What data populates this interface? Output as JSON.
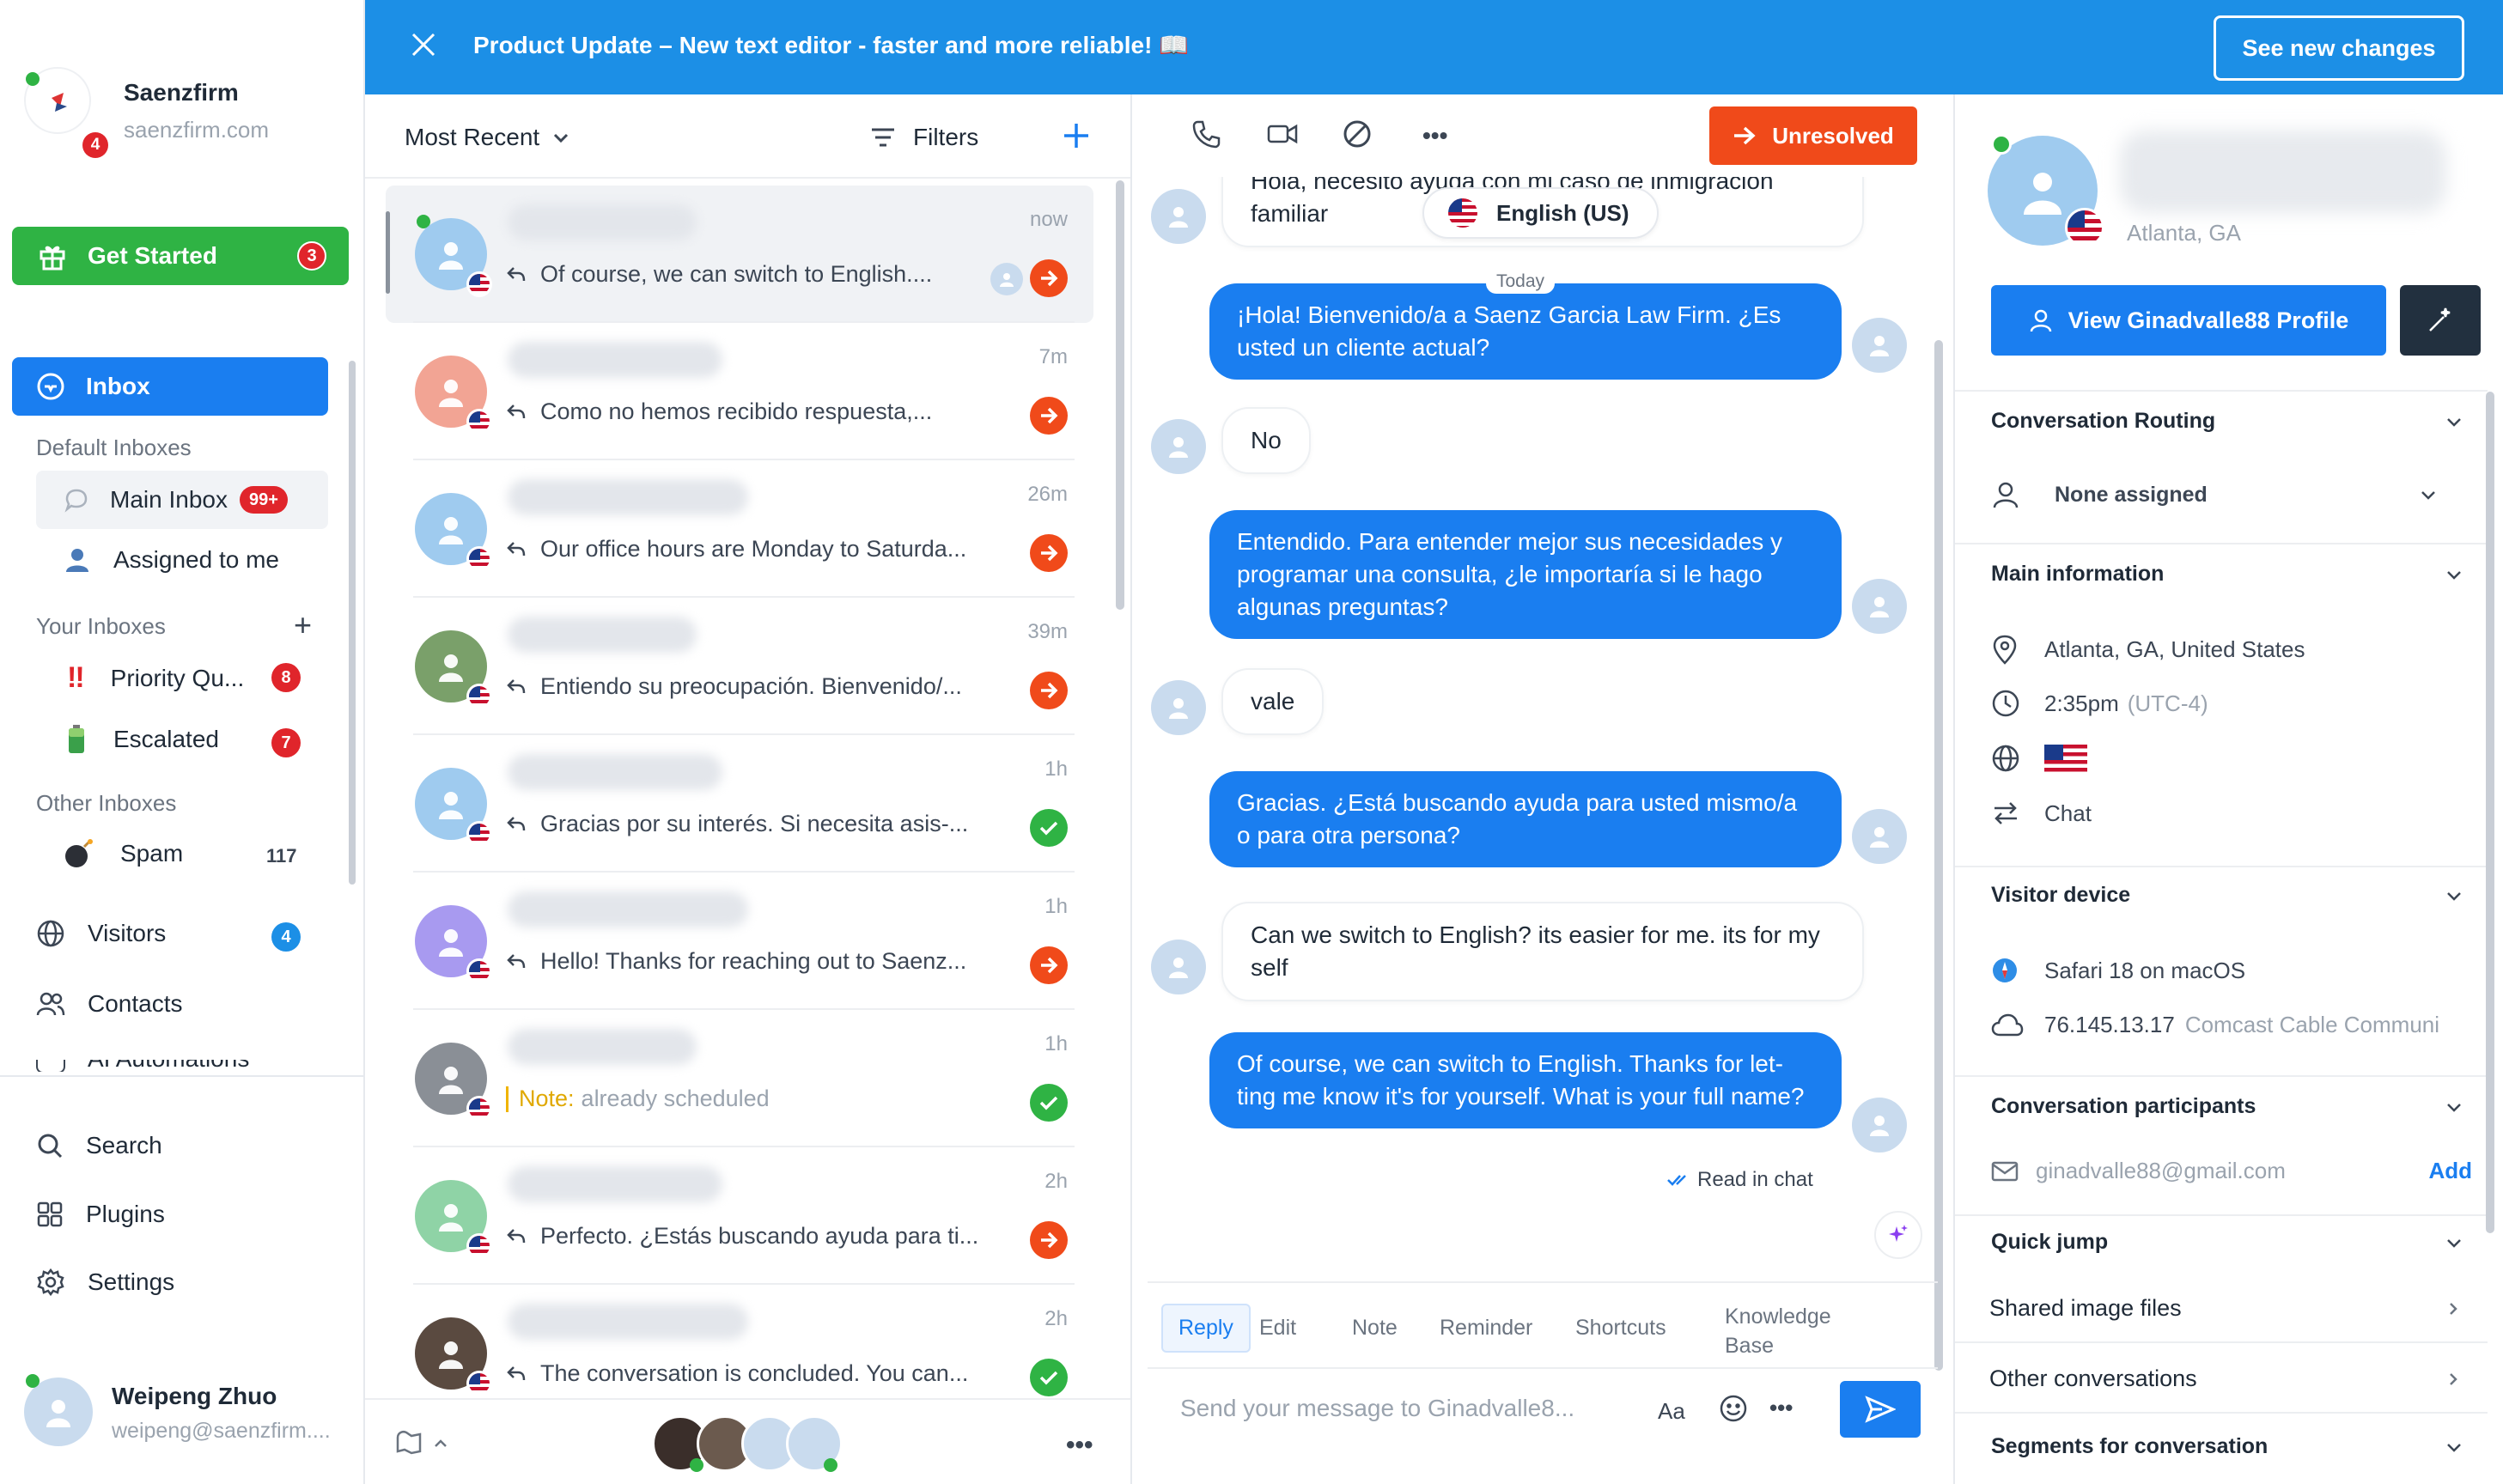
{
  "workspace": {
    "name": "Saenzfirm",
    "domain": "saenzfirm.com",
    "badge": "4"
  },
  "get_started": {
    "label": "Get Started",
    "count": "3"
  },
  "sidebar": {
    "inbox_label": "Inbox",
    "default_inboxes_title": "Default Inboxes",
    "main_inbox": {
      "label": "Main Inbox",
      "count": "99+"
    },
    "assigned_label": "Assigned to me",
    "your_inboxes_title": "Your Inboxes",
    "priority": {
      "label": "Priority Qu...",
      "count": "8"
    },
    "escalated": {
      "label": "Escalated",
      "count": "7"
    },
    "other_inboxes_title": "Other Inboxes",
    "spam": {
      "label": "Spam",
      "count": "117"
    },
    "visitors": {
      "label": "Visitors",
      "count": "4"
    },
    "contacts_label": "Contacts",
    "ai_label": "AI Automations",
    "search_label": "Search",
    "plugins_label": "Plugins",
    "settings_label": "Settings"
  },
  "user": {
    "name": "Weipeng Zhuo",
    "email": "weipeng@saenzfirm...."
  },
  "banner": {
    "text": "Product Update – New text editor - faster and more reliable! 📖",
    "button": "See new changes"
  },
  "list": {
    "sort_label": "Most Recent",
    "filters_label": "Filters",
    "rows": [
      {
        "time": "now",
        "preview": "Of course, we can switch to English....",
        "status": "arrow"
      },
      {
        "time": "7m",
        "preview": "Como no hemos recibido respuesta,...",
        "status": "arrow"
      },
      {
        "time": "26m",
        "preview": "Our office hours are Monday to Saturda...",
        "status": "arrow"
      },
      {
        "time": "39m",
        "preview": "Entiendo su preocupación. Bienvenido/...",
        "status": "arrow"
      },
      {
        "time": "1h",
        "preview": "Gracias por su interés. Si necesita asis-...",
        "status": "check"
      },
      {
        "time": "1h",
        "preview": "Hello! Thanks for reaching out to Saenz...",
        "status": "arrow"
      },
      {
        "time": "1h",
        "note_label": "Note:",
        "preview": "already scheduled",
        "status": "check"
      },
      {
        "time": "2h",
        "preview": "Perfecto. ¿Estás buscando ayuda para ti...",
        "status": "arrow"
      },
      {
        "time": "2h",
        "preview": "The conversation is concluded. You can...",
        "status": "check"
      }
    ]
  },
  "chat": {
    "unresolved_label": "Unresolved",
    "language_label": "English (US)",
    "today_label": "Today",
    "msg1": "Hola, necesito ayuda con mi caso de inmigración familiar",
    "msg2": "¡Hola! Bienvenido/a a Saenz Garcia Law Firm. ¿Es usted un cliente actual?",
    "msg3": "No",
    "msg4": "Entendido. Para entender mejor sus necesidades y programar una consulta, ¿le importaría si le hago algunas preguntas?",
    "msg5": "vale",
    "msg6": "Gracias. ¿Está buscando ayuda para usted mismo/a o para otra persona?",
    "msg7": "Can we switch to English? its easier for me. its for my self",
    "msg8": "Of course, we can switch to English. Thanks for let-ting me know it's for yourself. What is your full name?",
    "read_label": "Read in chat",
    "tabs": [
      "Reply",
      "Edit",
      "Note",
      "Reminder",
      "Shortcuts",
      "Knowledge Base"
    ],
    "placeholder": "Send your message to Ginadvalle8...",
    "aa_label": "Aa"
  },
  "contact": {
    "location_short": "Atlanta, GA",
    "profile_button": "View Ginadvalle88 Profile",
    "routing_title": "Conversation Routing",
    "assignee": "None assigned",
    "main_info_title": "Main information",
    "location_full": "Atlanta, GA, United States",
    "local_time": "2:35pm",
    "timezone": "(UTC-4)",
    "channel": "Chat",
    "device_title": "Visitor device",
    "browser": "Safari 18 on macOS",
    "ip": "76.145.13.17",
    "isp": "Comcast Cable Communi",
    "participants_title": "Conversation participants",
    "email": "ginadvalle88@gmail.com",
    "add_label": "Add",
    "quick_jump": "Quick jump",
    "shared_images": "Shared image files",
    "other_conversations": "Other conversations",
    "segments": "Segments for conversation"
  },
  "colors": {
    "accent": "#1a7ef0",
    "banner": "#1c8fe6",
    "unresolved": "#f04a1a",
    "green": "#2fb344",
    "red": "#e0252b"
  }
}
